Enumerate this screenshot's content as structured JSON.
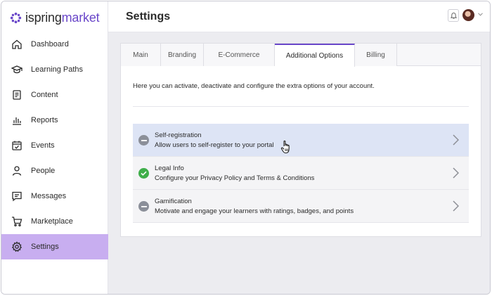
{
  "brand": {
    "name_part1": "ispring",
    "name_part2": "market",
    "accent_color": "#6a47c9"
  },
  "sidebar": {
    "items": [
      {
        "label": "Dashboard",
        "icon": "home-icon"
      },
      {
        "label": "Learning Paths",
        "icon": "graduation-cap-icon"
      },
      {
        "label": "Content",
        "icon": "document-icon"
      },
      {
        "label": "Reports",
        "icon": "bar-chart-icon"
      },
      {
        "label": "Events",
        "icon": "calendar-check-icon"
      },
      {
        "label": "People",
        "icon": "person-icon"
      },
      {
        "label": "Messages",
        "icon": "message-icon"
      },
      {
        "label": "Marketplace",
        "icon": "cart-icon"
      },
      {
        "label": "Settings",
        "icon": "gear-icon",
        "active": true
      }
    ],
    "active_color": "#c8aef0"
  },
  "header": {
    "title": "Settings"
  },
  "tabs": [
    {
      "label": "Main"
    },
    {
      "label": "Branding"
    },
    {
      "label": "E-Commerce"
    },
    {
      "label": "Additional Options",
      "active": true
    },
    {
      "label": "Billing"
    }
  ],
  "intro_text": "Here you can activate, deactivate and configure the extra options of your account.",
  "options": [
    {
      "title": "Self-registration",
      "description": "Allow users to self-register to your portal",
      "status": "disabled",
      "hovered": true
    },
    {
      "title": "Legal Info",
      "description": "Configure your Privacy Policy and Terms & Conditions",
      "status": "enabled"
    },
    {
      "title": "Gamification",
      "description": "Motivate and engage your learners with ratings, badges, and points",
      "status": "disabled"
    }
  ]
}
